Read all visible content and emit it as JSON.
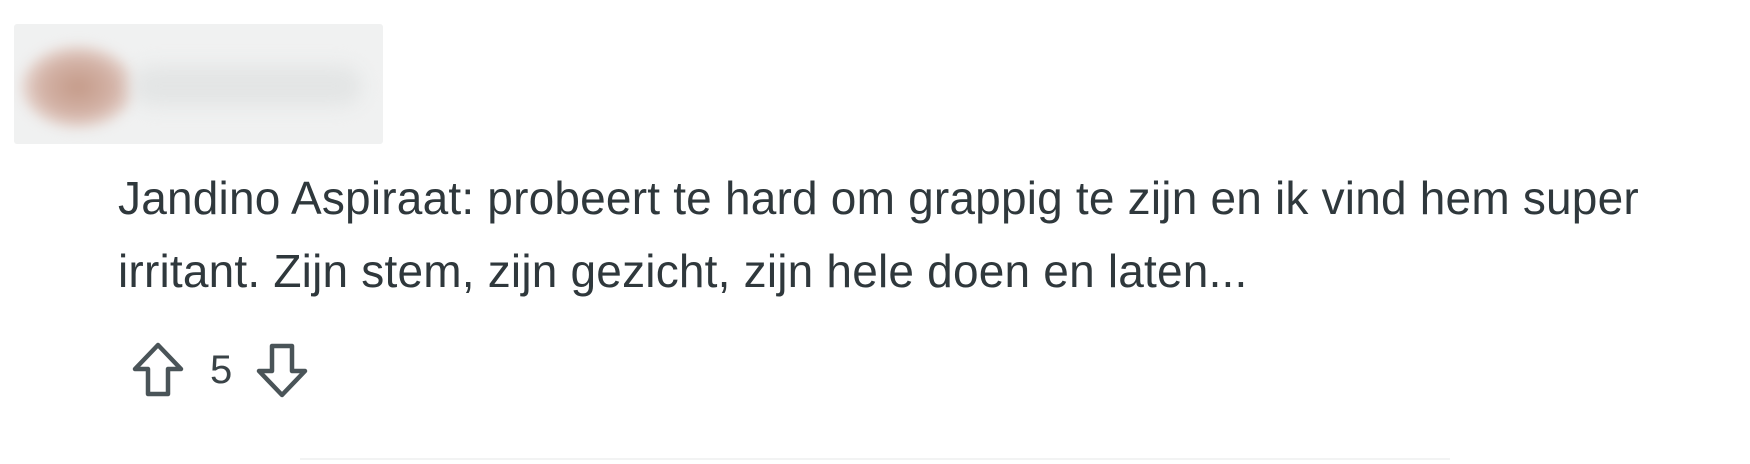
{
  "comment": {
    "author": {
      "name_redacted": true
    },
    "text": "Jandino Aspiraat: probeert te hard om grappig te zijn en ik vind hem super irritant. Zijn stem, zijn gezicht, zijn hele doen en laten...",
    "votes": {
      "score": "5"
    }
  },
  "icons": {
    "upvote": "arrow-up-outline-icon",
    "downvote": "arrow-down-outline-icon"
  },
  "colors": {
    "text": "#2f383c",
    "icon_stroke": "#4a5458",
    "blur_background": "#f0f1f1",
    "avatar_tint": "#c49a88"
  }
}
